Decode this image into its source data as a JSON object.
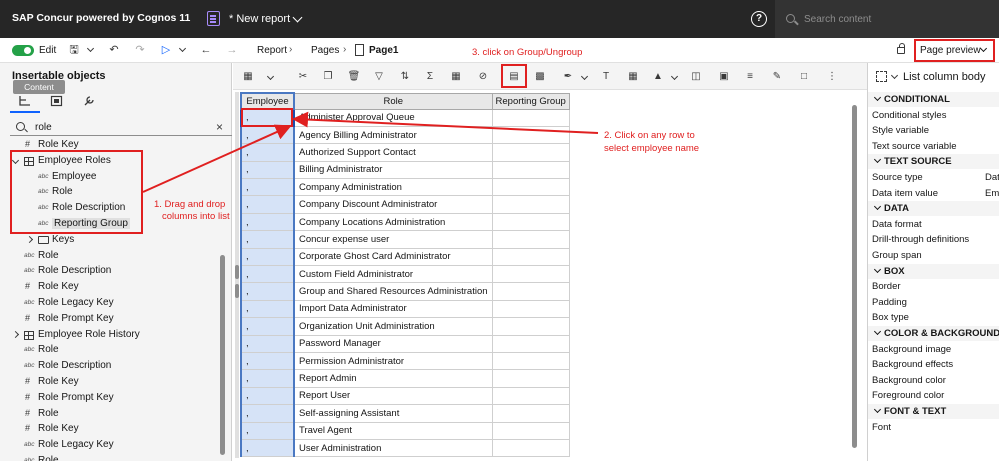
{
  "app": {
    "brand": "SAP Concur powered by Cognos 11",
    "report_name": "* New report",
    "search_placeholder": "Search content"
  },
  "toolbar": {
    "edit_label": "Edit",
    "breadcrumb": [
      "Report",
      "Pages",
      "Page1"
    ],
    "page_preview_label": "Page preview"
  },
  "left_panel": {
    "title": "Insertable objects",
    "tooltip": "Content",
    "filter_value": "role",
    "tree": [
      {
        "icon": "#",
        "label": "Role Key",
        "level": 1
      },
      {
        "icon": "grid",
        "label": "Employee Roles",
        "level": 0,
        "expanded": true
      },
      {
        "icon": "abc",
        "label": "Employee",
        "level": 2
      },
      {
        "icon": "abc",
        "label": "Role",
        "level": 2
      },
      {
        "icon": "abc",
        "label": "Role Description",
        "level": 2
      },
      {
        "icon": "abc",
        "label": "Reporting Group",
        "level": 2,
        "selected": true
      },
      {
        "icon": "folder",
        "label": "Keys",
        "level": 1,
        "collapsed": true
      },
      {
        "icon": "abc",
        "label": "Role",
        "level": 1
      },
      {
        "icon": "abc",
        "label": "Role Description",
        "level": 1
      },
      {
        "icon": "#",
        "label": "Role Key",
        "level": 1
      },
      {
        "icon": "abc",
        "label": "Role Legacy Key",
        "level": 1
      },
      {
        "icon": "#",
        "label": "Role Prompt Key",
        "level": 1
      },
      {
        "icon": "grid",
        "label": "Employee Role History",
        "level": 0,
        "collapsed": true
      },
      {
        "icon": "abc",
        "label": "Role",
        "level": 1
      },
      {
        "icon": "abc",
        "label": "Role Description",
        "level": 1
      },
      {
        "icon": "#",
        "label": "Role Key",
        "level": 1
      },
      {
        "icon": "#",
        "label": "Role Prompt Key",
        "level": 1
      },
      {
        "icon": "#",
        "label": "Role",
        "level": 1
      },
      {
        "icon": "#",
        "label": "Role Key",
        "level": 1
      },
      {
        "icon": "abc",
        "label": "Role Legacy Key",
        "level": 1
      },
      {
        "icon": "abc",
        "label": "Role",
        "level": 1
      }
    ]
  },
  "annotations": {
    "step1_line1": "1. Drag and drop",
    "step1_line2": "columns into list",
    "step2_line1": "2. Click on any row to",
    "step2_line2": "select employee name",
    "step3": "3. click on Group/Ungroup"
  },
  "list": {
    "columns": [
      "Employee",
      "Role",
      "Reporting Group"
    ],
    "employee_placeholder": ",",
    "roles": [
      "Administer Approval Queue",
      "Agency Billing Administrator",
      "Authorized Support Contact",
      "Billing Administrator",
      "Company Administration",
      "Company Discount Administrator",
      "Company Locations Administration",
      "Concur expense user",
      "Corporate Ghost Card Administrator",
      "Custom Field Administrator",
      "Group and Shared Resources Administration",
      "Import Data Administrator",
      "Organization Unit Administration",
      "Password Manager",
      "Permission Administrator",
      "Report Admin",
      "Report User",
      "Self-assigning Assistant",
      "Travel Agent",
      "User Administration"
    ]
  },
  "right_panel": {
    "title": "List column body",
    "sections": [
      {
        "name": "CONDITIONAL",
        "rows": [
          "Conditional styles",
          "Style variable",
          "Text source variable"
        ]
      },
      {
        "name": "TEXT SOURCE",
        "rows": [
          "Source type",
          "Data item value"
        ]
      },
      {
        "name": "DATA",
        "rows": [
          "Data format",
          "Drill-through definitions",
          "Group span"
        ]
      },
      {
        "name": "BOX",
        "rows": [
          "Border",
          "Padding",
          "Box type"
        ]
      },
      {
        "name": "COLOR & BACKGROUND",
        "rows": [
          "Background image",
          "Background effects",
          "Background color",
          "Foreground color"
        ]
      },
      {
        "name": "FONT & TEXT",
        "rows": [
          "Font"
        ]
      }
    ],
    "values": {
      "Source type": "Dat",
      "Data item value": "Em"
    }
  },
  "colors": {
    "accent": "#0f62fe",
    "callout": "#e02020",
    "toggle": "#24a148",
    "topbar": "#262626"
  }
}
